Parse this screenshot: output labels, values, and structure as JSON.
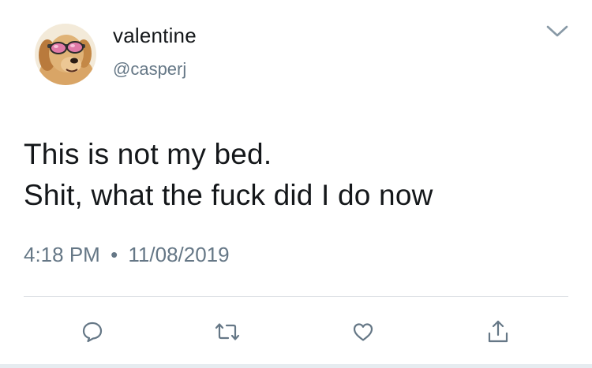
{
  "tweet": {
    "display_name": "valentine",
    "handle": "@casperj",
    "avatar_icon": "avatar-dog-sunglasses",
    "text_lines": [
      "This is not my bed.",
      "Shit, what the fuck did I do now"
    ],
    "time": "4:18 PM",
    "separator": "•",
    "date": "11/08/2019"
  },
  "actions": {
    "icons": [
      "reply-icon",
      "retweet-icon",
      "like-icon",
      "share-icon"
    ]
  },
  "colors": {
    "text_primary": "#14171a",
    "text_secondary": "#657786",
    "icon_gray": "#657786",
    "divider": "#d7dbdf"
  }
}
